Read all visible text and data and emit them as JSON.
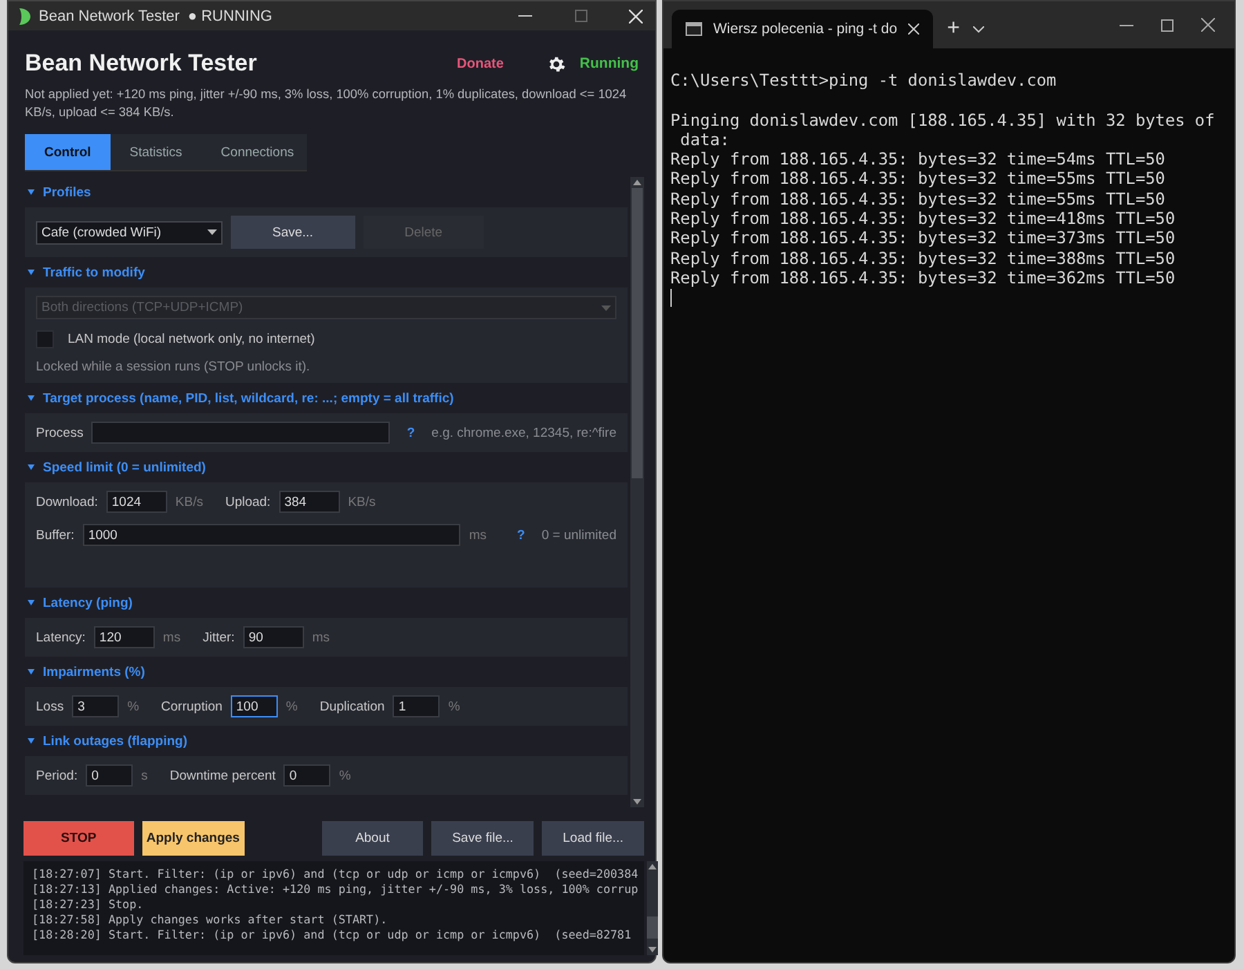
{
  "app_window": {
    "title": "Bean Network Tester",
    "status": "● RUNNING",
    "header": {
      "title": "Bean Network Tester",
      "donate": "Donate",
      "state": "Running",
      "summary": "Not applied yet: +120 ms ping, jitter +/-90 ms, 3% loss, 100% corruption, 1% duplicates, download <= 1024 KB/s, upload <= 384 KB/s."
    },
    "tabs": [
      {
        "label": "Control",
        "selected": true
      },
      {
        "label": "Statistics",
        "selected": false
      },
      {
        "label": "Connections",
        "selected": false
      }
    ],
    "sections": [
      {
        "title": "Profiles",
        "rows": [
          [
            {
              "kind": "select",
              "value": "Cafe (crowded WiFi)",
              "disabled": false
            },
            {
              "kind": "button",
              "label": "Save...",
              "disabled": false
            },
            {
              "kind": "button",
              "label": "Delete",
              "disabled": true
            }
          ]
        ]
      },
      {
        "title": "Traffic to modify",
        "rows": [
          [
            {
              "kind": "wide_select",
              "value": "Both directions (TCP+UDP+ICMP)",
              "disabled": true
            }
          ],
          [
            {
              "kind": "checkbox",
              "label": "LAN mode (local network only, no internet)",
              "checked": false
            }
          ],
          [
            {
              "kind": "note",
              "text": "Locked while a session runs (STOP unlocks it)."
            }
          ]
        ]
      },
      {
        "title": "Target process  (name, PID, list, wildcard, re: ...; empty = all traffic)",
        "rows": [
          [
            {
              "kind": "label",
              "text": "Process"
            },
            {
              "kind": "long_input",
              "focused": false
            },
            {
              "kind": "help",
              "text": "?"
            },
            {
              "kind": "hint",
              "text": "e.g. chrome.exe, 12345, re:^fire"
            }
          ]
        ]
      },
      {
        "title": "Speed limit  (0 = unlimited)",
        "tall": true,
        "rows": [
          [
            {
              "kind": "label",
              "text": "Download:"
            },
            {
              "kind": "input",
              "value": "1024",
              "focused": false
            },
            {
              "kind": "unit",
              "text": "KB/s"
            },
            {
              "kind": "label",
              "text": "Upload:"
            },
            {
              "kind": "input",
              "value": "384",
              "focused": false
            },
            {
              "kind": "unit",
              "text": "KB/s"
            }
          ],
          [
            {
              "kind": "label",
              "text": "Buffer:"
            },
            {
              "kind": "long_input",
              "value": "1000",
              "focused": false
            },
            {
              "kind": "unit",
              "text": "ms"
            },
            {
              "kind": "help",
              "text": "?"
            },
            {
              "kind": "hint",
              "text": "0 = unlimited"
            }
          ]
        ]
      },
      {
        "title": "Latency (ping)",
        "rows": [
          [
            {
              "kind": "label",
              "text": "Latency:"
            },
            {
              "kind": "input",
              "value": "120",
              "focused": false
            },
            {
              "kind": "unit",
              "text": "ms"
            },
            {
              "kind": "label",
              "text": "Jitter:"
            },
            {
              "kind": "input",
              "value": "90",
              "focused": false
            },
            {
              "kind": "unit",
              "text": "ms"
            }
          ]
        ]
      },
      {
        "title": "Impairments (%)",
        "rows": [
          [
            {
              "kind": "label",
              "text": "Loss"
            },
            {
              "kind": "small_input",
              "value": "3",
              "focused": false
            },
            {
              "kind": "unit",
              "text": "%"
            },
            {
              "kind": "label",
              "text": "Corruption"
            },
            {
              "kind": "small_input",
              "value": "100",
              "focused": true
            },
            {
              "kind": "unit",
              "text": "%"
            },
            {
              "kind": "label",
              "text": "Duplication"
            },
            {
              "kind": "small_input",
              "value": "1",
              "focused": false
            },
            {
              "kind": "unit",
              "text": "%"
            }
          ]
        ]
      },
      {
        "title": "Link outages (flapping)",
        "rows": [
          [
            {
              "kind": "label",
              "text": "Period:"
            },
            {
              "kind": "small_input",
              "value": "0",
              "focused": false
            },
            {
              "kind": "unit",
              "text": "s"
            },
            {
              "kind": "label",
              "text": "Downtime percent"
            },
            {
              "kind": "small_input",
              "value": "0",
              "focused": false
            },
            {
              "kind": "unit",
              "text": "%"
            }
          ]
        ]
      }
    ],
    "actions": [
      {
        "label": "STOP",
        "kind": "stop"
      },
      {
        "label": "Apply changes",
        "kind": "apply"
      },
      {
        "label": "About",
        "kind": "plain"
      },
      {
        "label": "Save file...",
        "kind": "plain"
      },
      {
        "label": "Load file...",
        "kind": "plain"
      }
    ],
    "log": [
      "[18:27:07] Start. Filter: (ip or ipv6) and (tcp or udp or icmp or icmpv6)  (seed=200384",
      "[18:27:13] Applied changes: Active: +120 ms ping, jitter +/-90 ms, 3% loss, 100% corrup",
      "[18:27:23] Stop.",
      "[18:27:58] Apply changes works after start (START).",
      "[18:28:20] Start. Filter: (ip or ipv6) and (tcp or udp or icmp or icmpv6)  (seed=82781"
    ]
  },
  "terminal_window": {
    "tab_title": "Wiersz polecenia - ping  -t do",
    "new_tab": "+",
    "blocks": [
      [
        "C:\\Users\\Testtt>ping -t donislawdev.com"
      ],
      [
        "Pinging donislawdev.com [188.165.4.35] with 32 bytes of",
        " data:",
        "Reply from 188.165.4.35: bytes=32 time=54ms TTL=50",
        "Reply from 188.165.4.35: bytes=32 time=55ms TTL=50",
        "Reply from 188.165.4.35: bytes=32 time=55ms TTL=50",
        "Reply from 188.165.4.35: bytes=32 time=418ms TTL=50",
        "Reply from 188.165.4.35: bytes=32 time=373ms TTL=50",
        "Reply from 188.165.4.35: bytes=32 time=388ms TTL=50",
        "Reply from 188.165.4.35: bytes=32 time=362ms TTL=50"
      ]
    ]
  }
}
